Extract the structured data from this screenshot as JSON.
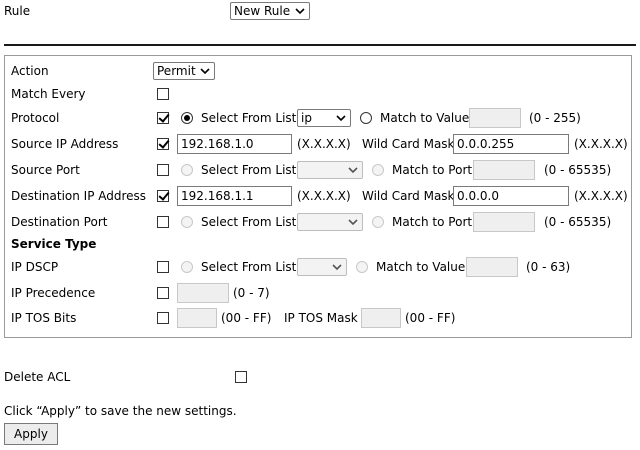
{
  "top": {
    "rule_label": "Rule",
    "rule_select": "New Rule"
  },
  "form": {
    "action": {
      "label": "Action",
      "value": "Permit"
    },
    "match_every": {
      "label": "Match Every",
      "checked": false
    },
    "protocol": {
      "label": "Protocol",
      "checked": true,
      "select_from_list": "Select From List",
      "list_value": "ip",
      "match_to_value": "Match to Value",
      "range": "(0 - 255)"
    },
    "source_ip": {
      "label": "Source IP Address",
      "checked": true,
      "value": "192.168.1.0",
      "format": "(X.X.X.X)",
      "mask_label": "Wild Card Mask",
      "mask_value": "0.0.0.255",
      "mask_format": "(X.X.X.X)"
    },
    "source_port": {
      "label": "Source Port",
      "checked": false,
      "select_from_list": "Select From List",
      "match_to_port": "Match to Port",
      "range": "(0 - 65535)"
    },
    "destination_ip": {
      "label": "Destination IP Address",
      "checked": true,
      "value": "192.168.1.1",
      "format": "(X.X.X.X)",
      "mask_label": "Wild Card Mask",
      "mask_value": "0.0.0.0",
      "mask_format": "(X.X.X.X)"
    },
    "destination_port": {
      "label": "Destination Port",
      "checked": false,
      "select_from_list": "Select From List",
      "match_to_port": "Match to Port",
      "range": "(0 - 65535)"
    },
    "service_type": {
      "heading": "Service Type"
    },
    "ip_dscp": {
      "label": "IP DSCP",
      "checked": false,
      "select_from_list": "Select From List",
      "match_to_value": "Match to Value",
      "range": "(0 - 63)"
    },
    "ip_precedence": {
      "label": "IP Precedence",
      "checked": false,
      "range": "(0 - 7)"
    },
    "ip_tos_bits": {
      "label": "IP TOS Bits",
      "checked": false,
      "range": "(00 - FF)",
      "mask_label": "IP TOS Mask",
      "mask_range": "(00 - FF)"
    }
  },
  "bottom": {
    "delete_acl": "Delete ACL",
    "apply_hint": "Click “Apply” to save the new settings.",
    "apply_button": "Apply"
  },
  "icons": {
    "dropdown": "chevron-down-icon",
    "checkbox_mark": "checkmark-icon"
  },
  "colors": {
    "rule_line": "#1a1a1a",
    "panel_border": "#9a9a9a",
    "disabled_field": "#efefef"
  }
}
